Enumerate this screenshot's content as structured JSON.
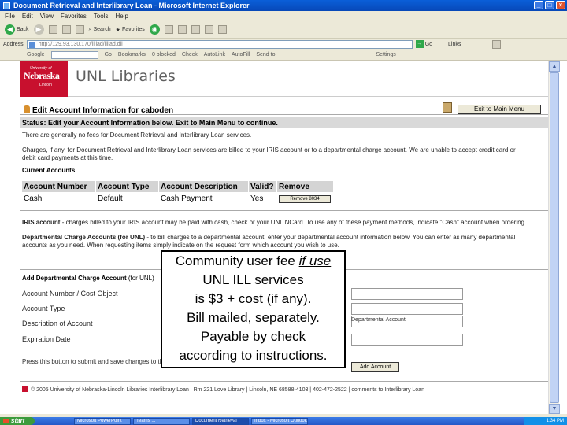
{
  "window": {
    "title": "Document Retrieval and Interlibrary Loan - Microsoft Internet Explorer"
  },
  "menubar": {
    "items": [
      "File",
      "Edit",
      "View",
      "Favorites",
      "Tools",
      "Help"
    ]
  },
  "toolbar": {
    "back": "Back",
    "search": "Search",
    "favorites": "Favorites"
  },
  "addressbar": {
    "label": "Address",
    "url": "http://129.93.130.170/illiad/illiad.dll",
    "go": "Go",
    "links": "Links"
  },
  "googlebar": {
    "label": "Google",
    "go": "Go",
    "bookmarks": "Bookmarks",
    "blocked": "0 blocked",
    "check": "Check",
    "autolink": "AutoLink",
    "autofill": "AutoFill",
    "send": "Send to",
    "settings": "Settings"
  },
  "header": {
    "nebraska_top": "University of",
    "nebraska": "Nebraska",
    "nebraska_sub": "Lincoln",
    "libraries": "UNL Libraries"
  },
  "page": {
    "title": "Edit Account Information for caboden",
    "main_menu": "Exit to Main Menu",
    "status": "Status: Edit your Account Information below. Exit to Main Menu to continue.",
    "p1": "There are generally no fees for Document Retrieval and Interlibrary Loan services.",
    "p2a": "Charges, if any, for Document Retrieval and Interlibrary Loan services are billed to your IRIS account or to a departmental charge account. We are unable to accept credit card or",
    "p2b": "debit card payments at this time.",
    "current_accounts": "Current Accounts",
    "table": {
      "headers": [
        "Account Number",
        "Account Type",
        "Account Description",
        "Valid?",
        "Remove"
      ],
      "row": {
        "number": "Cash",
        "type": "Default",
        "description": "Cash Payment",
        "valid": "Yes",
        "remove": "Remove 8034"
      }
    },
    "iris_label": "IRIS account",
    "iris_text": "- charges billed to your IRIS account may be paid with cash, check or your UNL NCard. To use any of these payment methods, indicate \"Cash\" account when ordering.",
    "dept_label": "Departmental Charge Accounts (for UNL)",
    "dept_text_a": "- to bill charges to a departmental account, enter your departmental account information below. You can enter as many departmental",
    "dept_text_b": "accounts as you need. When requesting items simply indicate on the request form which account you wish to use.",
    "add_dept": "Add Departmental Charge Account",
    "add_dept_suffix": "(for UNL)",
    "fields": {
      "number": "Account Number / Cost Object",
      "type": "Account Type",
      "description": "Description of Account",
      "expiration": "Expiration Date"
    },
    "dept_acct_value": "Departmental Account",
    "press": "Press this button to submit and save changes to the new account",
    "add_account": "Add Account",
    "footer": "© 2005 University of Nebraska-Lincoln Libraries Interlibrary Loan | Rm 221 Love Library | Lincoln, NE 68588-4103 | 402-472-2522 | comments to Interlibrary Loan"
  },
  "callout": {
    "lines": [
      "Community user fee if use",
      "UNL ILL services",
      "is $3 + cost (if any).",
      "Bill mailed, separately.",
      "Payable by check",
      "according to instructions."
    ]
  },
  "taskbar": {
    "start": "start",
    "tasks": [
      "Microsoft PowerPoint",
      "Teams ...",
      "Document Retrieval",
      "Inbox - Microsoft Outlook"
    ],
    "clock": "1:34 PM"
  }
}
